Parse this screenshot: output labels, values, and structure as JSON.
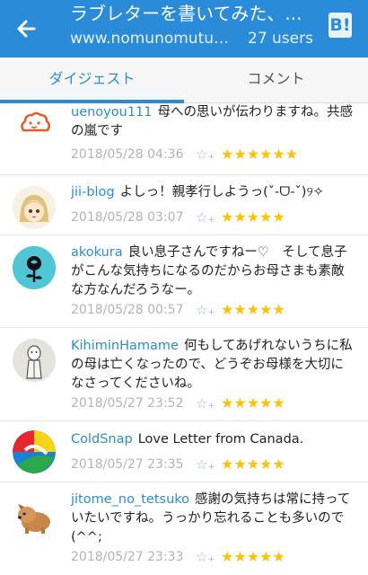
{
  "header": {
    "title": "ラブレターを書いてみた、...",
    "url": "www.nomunomutuk...",
    "users": "27 users",
    "bookmark_button": "B!"
  },
  "tabs": [
    {
      "label": "ダイジェスト",
      "active": true
    },
    {
      "label": "コメント",
      "active": false
    }
  ],
  "comments": [
    {
      "user": "uenoyou111",
      "text": "母への思いが伝わりますね。共感の嵐です",
      "date": "2018/05/28 04:36",
      "stars": "★★★★★★"
    },
    {
      "user": "jii-blog",
      "text": "よしっ！親孝行しようっ(ˇ-ᗜ-ˇ)୨✧",
      "date": "2018/05/28 03:07",
      "stars": "★★★★★"
    },
    {
      "user": "akokura",
      "text": "良い息子さんですねー♡　そして息子がこんな気持ちになるのだからお母さまも素敵な方なんだろうなー。",
      "date": "2018/05/28 00:57",
      "stars": "★★★★★"
    },
    {
      "user": "KihiminHamame",
      "text": "何もしてあげれないうちに私の母は亡くなったので、どうぞお母様を大切になさってくださいね。",
      "date": "2018/05/27 23:52",
      "stars": "★★★★★"
    },
    {
      "user": "ColdSnap",
      "text": "Love Letter from Canada.",
      "date": "2018/05/27 23:35",
      "stars": "★★★★★"
    },
    {
      "user": "jitome_no_tetsuko",
      "text": "感謝の気持ちは常に持っていたいですね。うっかり忘れることも多いので(^^;",
      "date": "2018/05/27 23:33",
      "stars": "★★★★★"
    }
  ],
  "colors": {
    "accent": "#2a8bd8",
    "star": "#ffc107"
  }
}
